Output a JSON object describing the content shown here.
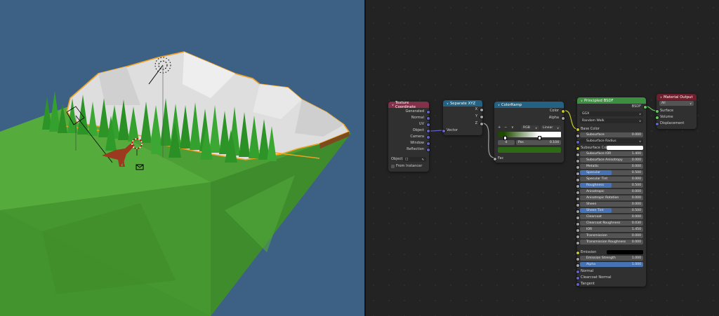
{
  "viewport": {
    "colors": {
      "background": "#3d6185",
      "ground": "#4a9a34",
      "mountain": "#dcdcdc",
      "selection": "#f0a020",
      "trees": "#2f9a2b"
    }
  },
  "nodes": {
    "texcoord": {
      "title": "Texture Coordinate",
      "outputs": [
        "Generated",
        "Normal",
        "UV",
        "Object",
        "Camera",
        "Window",
        "Reflection"
      ],
      "object_label": "Object:",
      "from_instancer": "From Instancer"
    },
    "separate": {
      "title": "Separate XYZ",
      "outputs": [
        "X",
        "Y",
        "Z"
      ],
      "input": "Vector"
    },
    "colorramp": {
      "title": "ColorRamp",
      "outputs": [
        "Color",
        "Alpha"
      ],
      "add": "+",
      "remove": "−",
      "menu": "∨",
      "mode": "RGB",
      "interp": "Linear",
      "stop_index": "0",
      "pos_label": "Pos",
      "pos_value": "0.104",
      "input": "Fac",
      "colors": {
        "stop_dark": "#1e4a00",
        "stop_light": "#ffffff",
        "swatch": "#2e6a16"
      }
    },
    "bsdf": {
      "title": "Principled BSDF",
      "output": "BSDF",
      "distribution": "GGX",
      "subsurface_method": "Random Walk",
      "base_color": "Base Color",
      "fields": [
        {
          "label": "Subsurface",
          "value": "0.000",
          "fill": 0
        },
        {
          "label": "Subsurface Radius",
          "value": "",
          "fill": 0,
          "dropdown": true
        },
        {
          "label": "Subsurface Color",
          "value": "",
          "fill": 0,
          "color": "#ffffff"
        },
        {
          "label": "Subsurface IOR",
          "value": "1.400",
          "fill": 0
        },
        {
          "label": "Subsurface Anisotropy",
          "value": "0.000",
          "fill": 0
        },
        {
          "label": "Metallic",
          "value": "0.000",
          "fill": 0
        },
        {
          "label": "Specular",
          "value": "0.500",
          "fill": 0.5
        },
        {
          "label": "Specular Tint",
          "value": "0.000",
          "fill": 0
        },
        {
          "label": "Roughness",
          "value": "0.500",
          "fill": 0.5
        },
        {
          "label": "Anisotropic",
          "value": "0.000",
          "fill": 0
        },
        {
          "label": "Anisotropic Rotation",
          "value": "0.000",
          "fill": 0
        },
        {
          "label": "Sheen",
          "value": "0.000",
          "fill": 0
        },
        {
          "label": "Sheen Tint",
          "value": "0.500",
          "fill": 0.5
        },
        {
          "label": "Clearcoat",
          "value": "0.000",
          "fill": 0
        },
        {
          "label": "Clearcoat Roughness",
          "value": "0.030",
          "fill": 0
        },
        {
          "label": "IOR",
          "value": "1.450",
          "fill": 0
        },
        {
          "label": "Transmission",
          "value": "0.000",
          "fill": 0
        },
        {
          "label": "Transmission Roughness",
          "value": "0.000",
          "fill": 0
        }
      ],
      "emission": "Emission",
      "emission_color": "#000000",
      "emission_strength": {
        "label": "Emission Strength",
        "value": "1.000"
      },
      "alpha": {
        "label": "Alpha",
        "value": "1.000",
        "fill": 1
      },
      "vector_inputs": [
        "Normal",
        "Clearcoat Normal",
        "Tangent"
      ]
    },
    "output": {
      "title": "Material Output",
      "target": "All",
      "inputs": [
        "Surface",
        "Volume",
        "Displacement"
      ]
    }
  }
}
